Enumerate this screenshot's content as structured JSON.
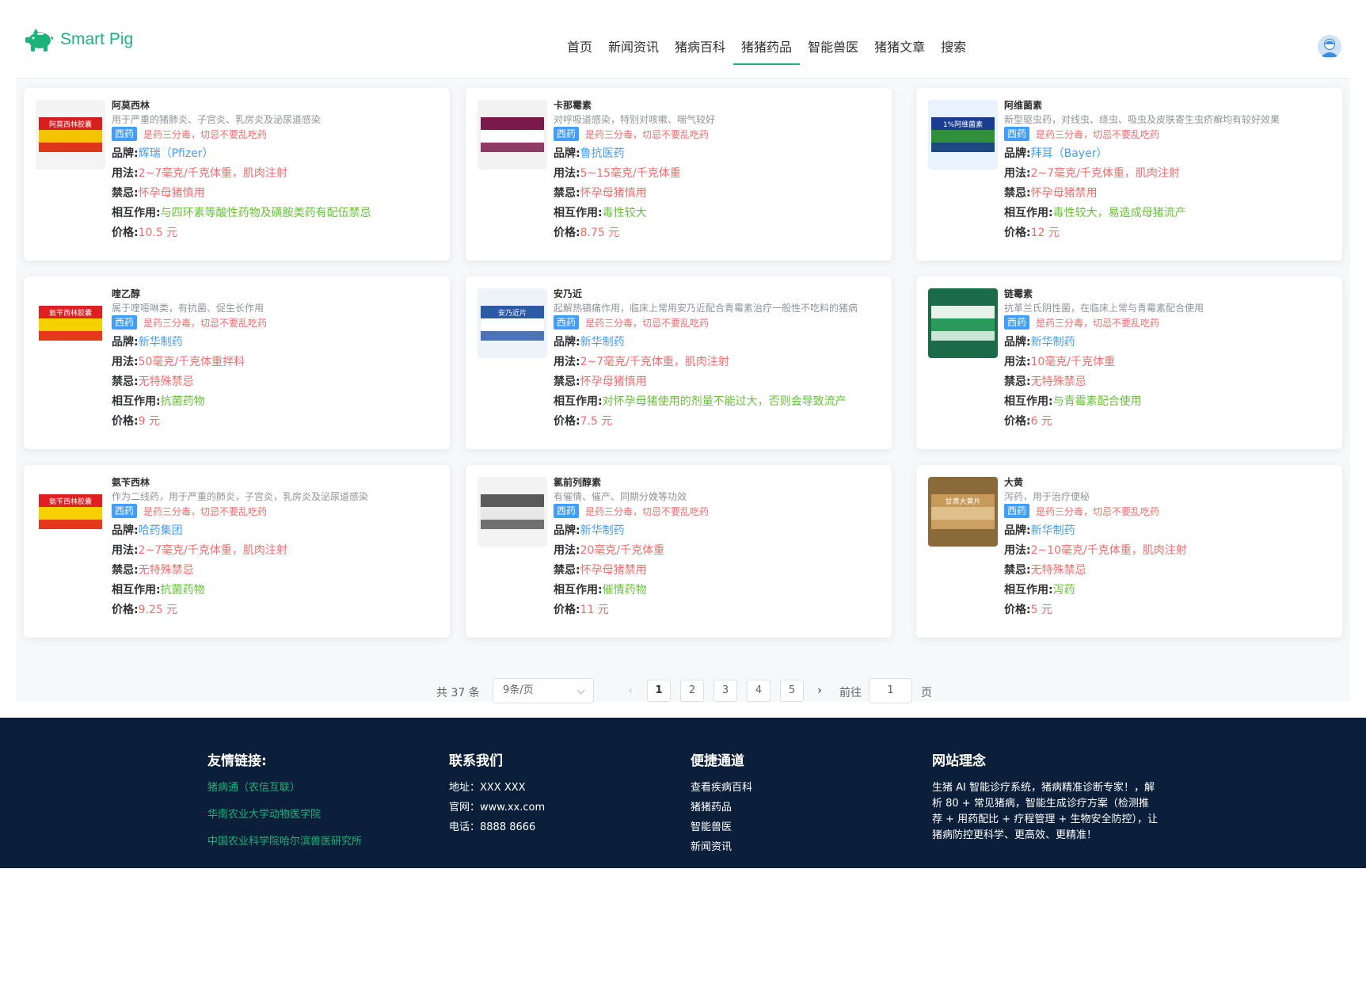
{
  "brand": {
    "name": "Smart Pig",
    "accent": "#1bb37a"
  },
  "nav": [
    "首页",
    "新闻资讯",
    "猪病百科",
    "猪猪药品",
    "智能兽医",
    "猪猪文章",
    "搜索"
  ],
  "nav_active": "猪猪药品",
  "labels": {
    "brand": "品牌:",
    "usage": "用法:",
    "taboo": "禁忌:",
    "interaction": "相互作用:",
    "price": "价格:"
  },
  "drugs": [
    {
      "name": "阿莫西林",
      "desc": "用于严重的猪肺炎、子宫炎、乳房炎及泌尿道感染",
      "tag": "西药",
      "warn": "是药三分毒，切忌不要乱吃药",
      "brand": "辉瑞（Pfizer）",
      "usage": "2~7毫克/千克体重，肌肉注射",
      "taboo": "怀孕母猪慎用",
      "interaction": "与四环素等酸性药物及磺胺类药有配伍禁忌",
      "price": "10.5 元"
    },
    {
      "name": "卡那霉素",
      "desc": "对呼吸道感染，特别对咳嗽、喘气较好",
      "tag": "西药",
      "warn": "是药三分毒，切忌不要乱吃药",
      "brand": "鲁抗医药",
      "usage": "5~15毫克/千克体重",
      "taboo": "怀孕母猪慎用",
      "interaction": "毒性较大",
      "price": "8.75 元"
    },
    {
      "name": "阿维菌素",
      "desc": "新型驱虫药，对线虫、绦虫、吸虫及皮肤寄生虫疥癣均有较好效果",
      "tag": "西药",
      "warn": "是药三分毒，切忌不要乱吃药",
      "brand": "拜耳（Bayer）",
      "usage": "2~7毫克/千克体重，肌肉注射",
      "taboo": "怀孕母猪禁用",
      "interaction": "毒性较大，易造成母猪流产",
      "price": "12 元"
    },
    {
      "name": "喹乙醇",
      "desc": "属于喹噁啉类，有抗菌、促生长作用",
      "tag": "西药",
      "warn": "是药三分毒，切忌不要乱吃药",
      "brand": "新华制药",
      "usage": "50毫克/千克体重拌料",
      "taboo": "无特殊禁忌",
      "interaction": "抗菌药物",
      "price": "9 元"
    },
    {
      "name": "安乃近",
      "desc": "起解热镇痛作用，临床上常用安乃近配合青霉素治疗一般性不吃料的猪病",
      "tag": "西药",
      "warn": "是药三分毒，切忌不要乱吃药",
      "brand": "新华制药",
      "usage": "2~7毫克/千克体重，肌肉注射",
      "taboo": "怀孕母猪慎用",
      "interaction": "对怀孕母猪使用的剂量不能过大，否则会导致流产",
      "price": "7.5 元"
    },
    {
      "name": "链霉素",
      "desc": "抗革兰氏阴性菌，在临床上常与青霉素配合使用",
      "tag": "西药",
      "warn": "是药三分毒，切忌不要乱吃药",
      "brand": "新华制药",
      "usage": "10毫克/千克体重",
      "taboo": "无特殊禁忌",
      "interaction": "与青霉素配合使用",
      "price": "6 元"
    },
    {
      "name": "氨苄西林",
      "desc": "作为二线药，用于严重的肺炎，子宫炎，乳房炎及泌尿道感染",
      "tag": "西药",
      "warn": "是药三分毒，切忌不要乱吃药",
      "brand": "哈药集团",
      "usage": "2~7毫克/千克体重，肌肉注射",
      "taboo": "无特殊禁忌",
      "interaction": "抗菌药物",
      "price": "9.25 元"
    },
    {
      "name": "氯前列醇素",
      "desc": "有催情、催产、同期分娩等功效",
      "tag": "西药",
      "warn": "是药三分毒，切忌不要乱吃药",
      "brand": "新华制药",
      "usage": "20毫克/千克体重",
      "taboo": "怀孕母猪禁用",
      "interaction": "催情药物",
      "price": "11 元"
    },
    {
      "name": "大黄",
      "desc": "泻药，用于治疗便秘",
      "tag": "西药",
      "warn": "是药三分毒，切忌不要乱吃药",
      "brand": "新华制药",
      "usage": "2~10毫克/千克体重，肌肉注射",
      "taboo": "无特殊禁忌",
      "interaction": "泻药",
      "price": "5 元"
    }
  ],
  "thumb_text": [
    "阿莫西林胶囊",
    "",
    "1%阿维菌素",
    "氨苄西林胶囊",
    "安乃近片",
    "",
    "氨苄西林胶囊",
    "",
    "甘肃大黄片"
  ],
  "pagination": {
    "total": "共 37 条",
    "page_size": "9条/页",
    "pages": [
      "1",
      "2",
      "3",
      "4",
      "5"
    ],
    "current": "1",
    "goto_label": "前往",
    "goto_value": "1",
    "page_suffix": "页"
  },
  "footer": {
    "links_title": "友情链接:",
    "links": [
      "猪病通（农信互联）",
      "华南农业大学动物医学院",
      "中国农业科学院哈尔滨兽医研究所"
    ],
    "contact_title": "联系我们",
    "contact": [
      "地址：XXX XXX",
      "官网：www.xx.com",
      "电话：8888 8666"
    ],
    "quick_title": "便捷通道",
    "quick": [
      "查看疾病百科",
      "猪猪药品",
      "智能兽医",
      "新闻资讯"
    ],
    "idea_title": "网站理念",
    "idea": "生猪 AI 智能诊疗系统，猪病精准诊断专家！，解析 80 + 常见猪病，智能生成诊疗方案（检测推荐 + 用药配比 + 疗程管理 + 生物安全防控），让猪病防控更科学、更高效、更精准！"
  }
}
